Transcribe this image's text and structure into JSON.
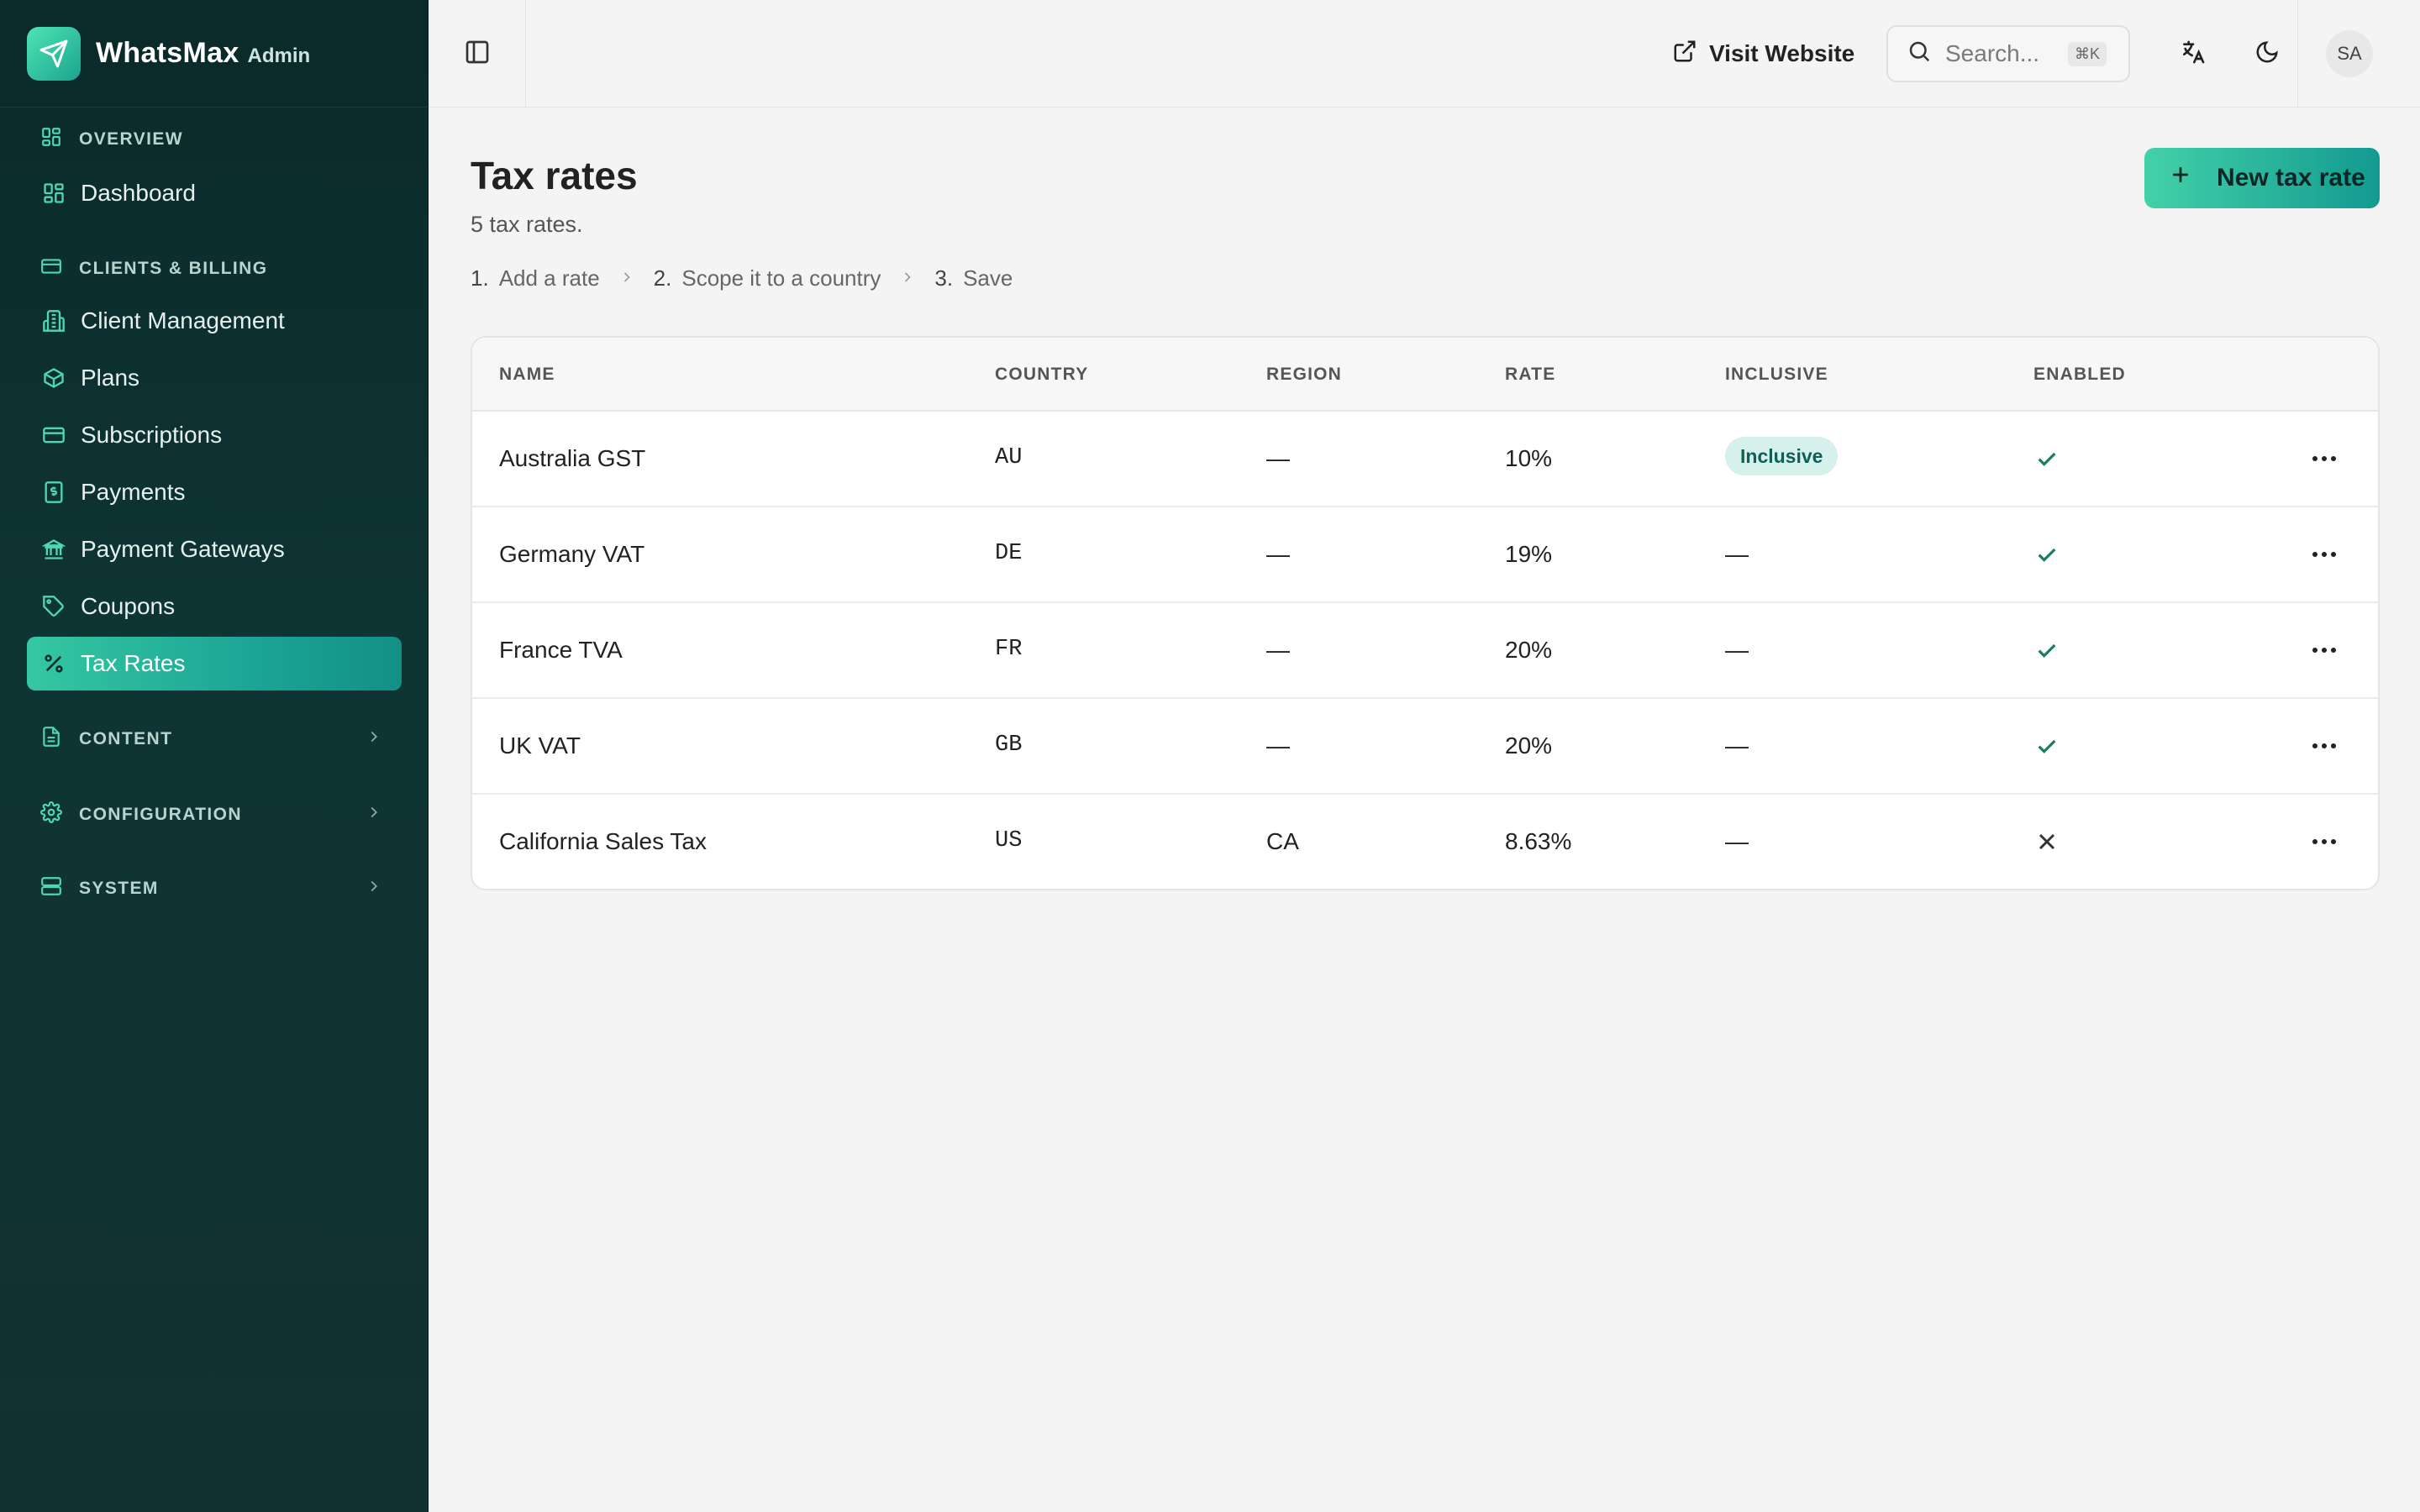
{
  "brand": {
    "name": "WhatsMax",
    "sub": "Admin"
  },
  "sidebar": {
    "overview_label": "OVERVIEW",
    "dashboard": "Dashboard",
    "billing_label": "CLIENTS & BILLING",
    "items": [
      "Client Management",
      "Plans",
      "Subscriptions",
      "Payments",
      "Payment Gateways",
      "Coupons",
      "Tax Rates"
    ],
    "content_label": "CONTENT",
    "configuration_label": "CONFIGURATION",
    "system_label": "SYSTEM"
  },
  "topbar": {
    "visit_website": "Visit Website",
    "search_placeholder": "Search...",
    "shortcut": "⌘K",
    "avatar": "SA"
  },
  "page": {
    "title": "Tax rates",
    "subtitle": "5 tax rates.",
    "steps": [
      {
        "num": "1.",
        "label": "Add a rate"
      },
      {
        "num": "2.",
        "label": "Scope it to a country"
      },
      {
        "num": "3.",
        "label": "Save"
      }
    ],
    "new_button": "New tax rate"
  },
  "table": {
    "columns": [
      "NAME",
      "COUNTRY",
      "REGION",
      "RATE",
      "INCLUSIVE",
      "ENABLED"
    ],
    "rows": [
      {
        "name": "Australia GST",
        "country": "AU",
        "region": "—",
        "rate": "10%",
        "inclusive": "Inclusive",
        "enabled": true
      },
      {
        "name": "Germany VAT",
        "country": "DE",
        "region": "—",
        "rate": "19%",
        "inclusive": "—",
        "enabled": true
      },
      {
        "name": "France TVA",
        "country": "FR",
        "region": "—",
        "rate": "20%",
        "inclusive": "—",
        "enabled": true
      },
      {
        "name": "UK VAT",
        "country": "GB",
        "region": "—",
        "rate": "20%",
        "inclusive": "—",
        "enabled": true
      },
      {
        "name": "California Sales Tax",
        "country": "US",
        "region": "CA",
        "rate": "8.63%",
        "inclusive": "—",
        "enabled": false
      }
    ]
  },
  "colors": {
    "accent": "#1ba596",
    "sidebar_bg": "#0e3534",
    "check": "#1b7d5c"
  }
}
